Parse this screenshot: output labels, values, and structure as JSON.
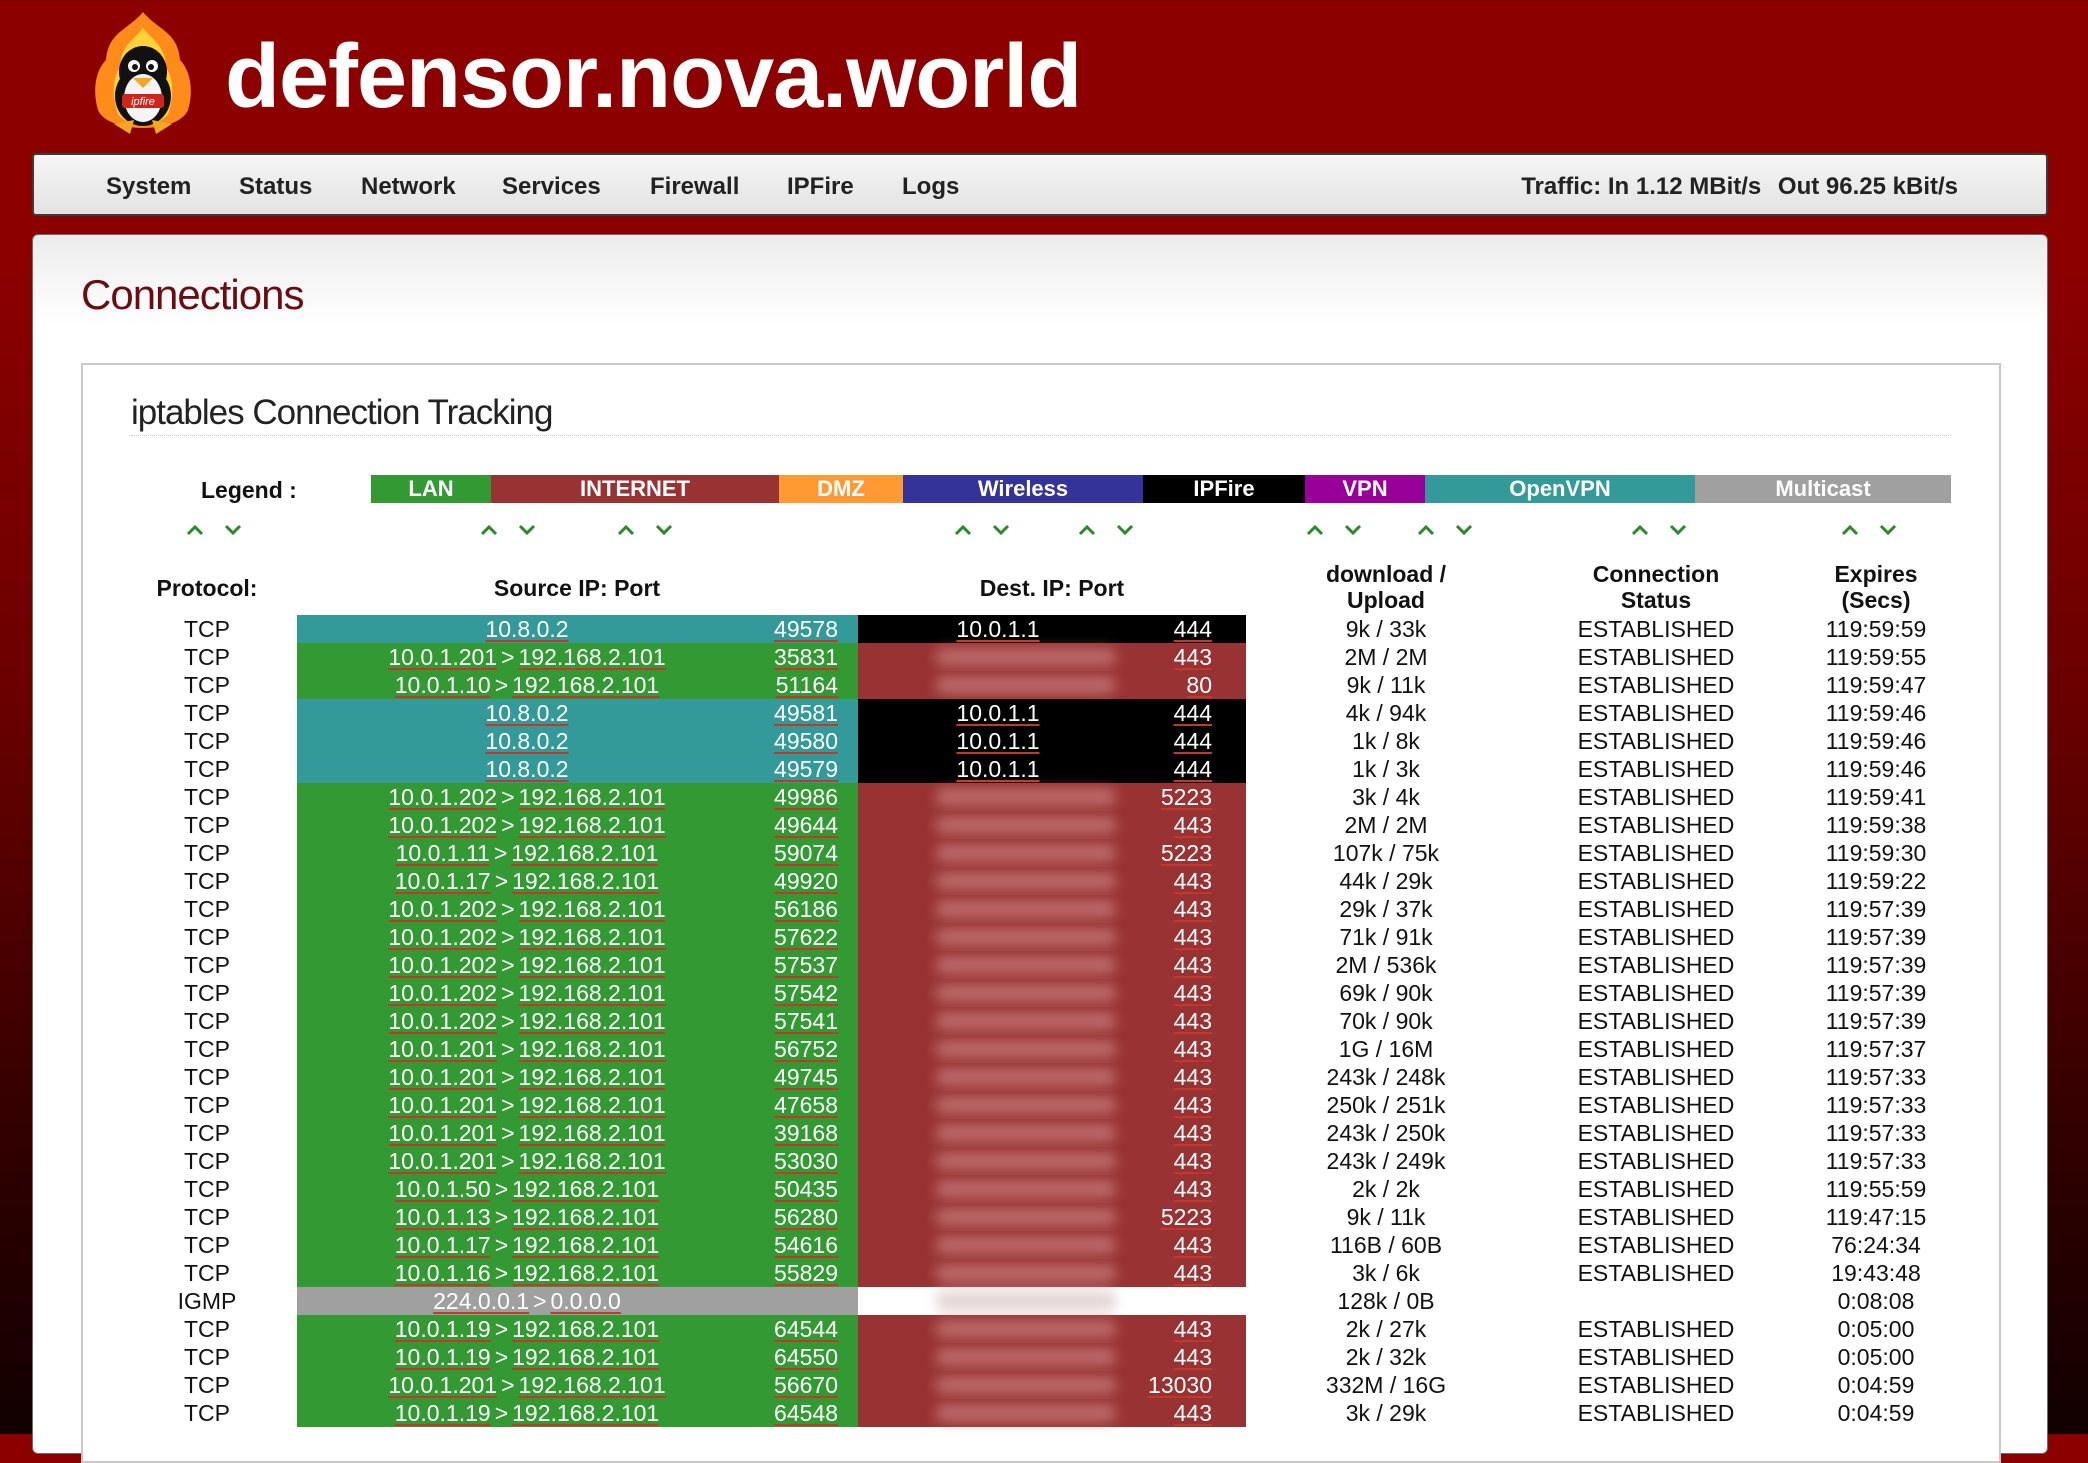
{
  "header": {
    "site_title": "defensor.nova.world",
    "logo_text": "ipfire"
  },
  "nav": {
    "items": [
      {
        "label": "System"
      },
      {
        "label": "Status"
      },
      {
        "label": "Network"
      },
      {
        "label": "Services"
      },
      {
        "label": "Firewall"
      },
      {
        "label": "IPFire"
      },
      {
        "label": "Logs"
      }
    ],
    "traffic_in": "Traffic: In 1.12 MBit/s",
    "traffic_out": "Out 96.25 kBit/s"
  },
  "page": {
    "heading": "Connections",
    "panel_title": "iptables Connection Tracking"
  },
  "legend": {
    "label": "Legend :",
    "items": [
      {
        "label": "LAN",
        "color": "#339933"
      },
      {
        "label": "INTERNET",
        "color": "#993333"
      },
      {
        "label": "DMZ",
        "color": "#ff9933"
      },
      {
        "label": "Wireless",
        "color": "#333399"
      },
      {
        "label": "IPFire",
        "color": "#000000"
      },
      {
        "label": "VPN",
        "color": "#990099"
      },
      {
        "label": "OpenVPN",
        "color": "#339999"
      },
      {
        "label": "Multicast",
        "color": "#a0a0a0"
      }
    ]
  },
  "columns": {
    "protocol": "Protocol:",
    "source": "Source IP: Port",
    "dest": "Dest. IP: Port",
    "download_line1": "download /",
    "download_line2": "Upload",
    "status_line1": "Connection",
    "status_line2": "Status",
    "expires_line1": "Expires",
    "expires_line2": "(Secs)"
  },
  "colors": {
    "lan": "#339933",
    "internet": "#993333",
    "openvpn": "#339999",
    "ipfire": "#000000",
    "multicast": "#a0a0a0",
    "arrow": "#2a8a2a"
  },
  "rows": [
    {
      "proto": "TCP",
      "src_type": "openvpn",
      "src_ip": "10.8.0.2",
      "src_nat": "",
      "src_port": "49578",
      "dst_type": "ipfire",
      "dst_ip": "10.0.1.1",
      "dst_port": "444",
      "traffic": "9k / 33k",
      "status": "ESTABLISHED",
      "expires": "119:59:59"
    },
    {
      "proto": "TCP",
      "src_type": "lan",
      "src_ip": "10.0.1.201",
      "src_nat": "192.168.2.101",
      "src_port": "35831",
      "dst_type": "internet",
      "dst_ip": "",
      "dst_port": "443",
      "traffic": "2M / 2M",
      "status": "ESTABLISHED",
      "expires": "119:59:55"
    },
    {
      "proto": "TCP",
      "src_type": "lan",
      "src_ip": "10.0.1.10",
      "src_nat": "192.168.2.101",
      "src_port": "51164",
      "dst_type": "internet",
      "dst_ip": "",
      "dst_port": "80",
      "traffic": "9k / 11k",
      "status": "ESTABLISHED",
      "expires": "119:59:47"
    },
    {
      "proto": "TCP",
      "src_type": "openvpn",
      "src_ip": "10.8.0.2",
      "src_nat": "",
      "src_port": "49581",
      "dst_type": "ipfire",
      "dst_ip": "10.0.1.1",
      "dst_port": "444",
      "traffic": "4k / 94k",
      "status": "ESTABLISHED",
      "expires": "119:59:46"
    },
    {
      "proto": "TCP",
      "src_type": "openvpn",
      "src_ip": "10.8.0.2",
      "src_nat": "",
      "src_port": "49580",
      "dst_type": "ipfire",
      "dst_ip": "10.0.1.1",
      "dst_port": "444",
      "traffic": "1k / 8k",
      "status": "ESTABLISHED",
      "expires": "119:59:46"
    },
    {
      "proto": "TCP",
      "src_type": "openvpn",
      "src_ip": "10.8.0.2",
      "src_nat": "",
      "src_port": "49579",
      "dst_type": "ipfire",
      "dst_ip": "10.0.1.1",
      "dst_port": "444",
      "traffic": "1k / 3k",
      "status": "ESTABLISHED",
      "expires": "119:59:46"
    },
    {
      "proto": "TCP",
      "src_type": "lan",
      "src_ip": "10.0.1.202",
      "src_nat": "192.168.2.101",
      "src_port": "49986",
      "dst_type": "internet",
      "dst_ip": "",
      "dst_port": "5223",
      "traffic": "3k / 4k",
      "status": "ESTABLISHED",
      "expires": "119:59:41"
    },
    {
      "proto": "TCP",
      "src_type": "lan",
      "src_ip": "10.0.1.202",
      "src_nat": "192.168.2.101",
      "src_port": "49644",
      "dst_type": "internet",
      "dst_ip": "",
      "dst_port": "443",
      "traffic": "2M / 2M",
      "status": "ESTABLISHED",
      "expires": "119:59:38"
    },
    {
      "proto": "TCP",
      "src_type": "lan",
      "src_ip": "10.0.1.11",
      "src_nat": "192.168.2.101",
      "src_port": "59074",
      "dst_type": "internet",
      "dst_ip": "",
      "dst_port": "5223",
      "traffic": "107k / 75k",
      "status": "ESTABLISHED",
      "expires": "119:59:30"
    },
    {
      "proto": "TCP",
      "src_type": "lan",
      "src_ip": "10.0.1.17",
      "src_nat": "192.168.2.101",
      "src_port": "49920",
      "dst_type": "internet",
      "dst_ip": "",
      "dst_port": "443",
      "traffic": "44k / 29k",
      "status": "ESTABLISHED",
      "expires": "119:59:22"
    },
    {
      "proto": "TCP",
      "src_type": "lan",
      "src_ip": "10.0.1.202",
      "src_nat": "192.168.2.101",
      "src_port": "56186",
      "dst_type": "internet",
      "dst_ip": "",
      "dst_port": "443",
      "traffic": "29k / 37k",
      "status": "ESTABLISHED",
      "expires": "119:57:39"
    },
    {
      "proto": "TCP",
      "src_type": "lan",
      "src_ip": "10.0.1.202",
      "src_nat": "192.168.2.101",
      "src_port": "57622",
      "dst_type": "internet",
      "dst_ip": "",
      "dst_port": "443",
      "traffic": "71k / 91k",
      "status": "ESTABLISHED",
      "expires": "119:57:39"
    },
    {
      "proto": "TCP",
      "src_type": "lan",
      "src_ip": "10.0.1.202",
      "src_nat": "192.168.2.101",
      "src_port": "57537",
      "dst_type": "internet",
      "dst_ip": "",
      "dst_port": "443",
      "traffic": "2M / 536k",
      "status": "ESTABLISHED",
      "expires": "119:57:39"
    },
    {
      "proto": "TCP",
      "src_type": "lan",
      "src_ip": "10.0.1.202",
      "src_nat": "192.168.2.101",
      "src_port": "57542",
      "dst_type": "internet",
      "dst_ip": "",
      "dst_port": "443",
      "traffic": "69k / 90k",
      "status": "ESTABLISHED",
      "expires": "119:57:39"
    },
    {
      "proto": "TCP",
      "src_type": "lan",
      "src_ip": "10.0.1.202",
      "src_nat": "192.168.2.101",
      "src_port": "57541",
      "dst_type": "internet",
      "dst_ip": "",
      "dst_port": "443",
      "traffic": "70k / 90k",
      "status": "ESTABLISHED",
      "expires": "119:57:39"
    },
    {
      "proto": "TCP",
      "src_type": "lan",
      "src_ip": "10.0.1.201",
      "src_nat": "192.168.2.101",
      "src_port": "56752",
      "dst_type": "internet",
      "dst_ip": "",
      "dst_port": "443",
      "traffic": "1G / 16M",
      "status": "ESTABLISHED",
      "expires": "119:57:37"
    },
    {
      "proto": "TCP",
      "src_type": "lan",
      "src_ip": "10.0.1.201",
      "src_nat": "192.168.2.101",
      "src_port": "49745",
      "dst_type": "internet",
      "dst_ip": "",
      "dst_port": "443",
      "traffic": "243k / 248k",
      "status": "ESTABLISHED",
      "expires": "119:57:33"
    },
    {
      "proto": "TCP",
      "src_type": "lan",
      "src_ip": "10.0.1.201",
      "src_nat": "192.168.2.101",
      "src_port": "47658",
      "dst_type": "internet",
      "dst_ip": "",
      "dst_port": "443",
      "traffic": "250k / 251k",
      "status": "ESTABLISHED",
      "expires": "119:57:33"
    },
    {
      "proto": "TCP",
      "src_type": "lan",
      "src_ip": "10.0.1.201",
      "src_nat": "192.168.2.101",
      "src_port": "39168",
      "dst_type": "internet",
      "dst_ip": "",
      "dst_port": "443",
      "traffic": "243k / 250k",
      "status": "ESTABLISHED",
      "expires": "119:57:33"
    },
    {
      "proto": "TCP",
      "src_type": "lan",
      "src_ip": "10.0.1.201",
      "src_nat": "192.168.2.101",
      "src_port": "53030",
      "dst_type": "internet",
      "dst_ip": "",
      "dst_port": "443",
      "traffic": "243k / 249k",
      "status": "ESTABLISHED",
      "expires": "119:57:33"
    },
    {
      "proto": "TCP",
      "src_type": "lan",
      "src_ip": "10.0.1.50",
      "src_nat": "192.168.2.101",
      "src_port": "50435",
      "dst_type": "internet",
      "dst_ip": "",
      "dst_port": "443",
      "traffic": "2k / 2k",
      "status": "ESTABLISHED",
      "expires": "119:55:59"
    },
    {
      "proto": "TCP",
      "src_type": "lan",
      "src_ip": "10.0.1.13",
      "src_nat": "192.168.2.101",
      "src_port": "56280",
      "dst_type": "internet",
      "dst_ip": "",
      "dst_port": "5223",
      "traffic": "9k / 11k",
      "status": "ESTABLISHED",
      "expires": "119:47:15"
    },
    {
      "proto": "TCP",
      "src_type": "lan",
      "src_ip": "10.0.1.17",
      "src_nat": "192.168.2.101",
      "src_port": "54616",
      "dst_type": "internet",
      "dst_ip": "",
      "dst_port": "443",
      "traffic": "116B / 60B",
      "status": "ESTABLISHED",
      "expires": "76:24:34"
    },
    {
      "proto": "TCP",
      "src_type": "lan",
      "src_ip": "10.0.1.16",
      "src_nat": "192.168.2.101",
      "src_port": "55829",
      "dst_type": "internet",
      "dst_ip": "",
      "dst_port": "443",
      "traffic": "3k / 6k",
      "status": "ESTABLISHED",
      "expires": "19:43:48"
    },
    {
      "proto": "IGMP",
      "src_type": "multicast",
      "src_ip": "224.0.0.1",
      "src_nat": "0.0.0.0",
      "src_port": "",
      "dst_type": "none",
      "dst_ip": "",
      "dst_port": "",
      "traffic": "128k / 0B",
      "status": "",
      "expires": "0:08:08"
    },
    {
      "proto": "TCP",
      "src_type": "lan",
      "src_ip": "10.0.1.19",
      "src_nat": "192.168.2.101",
      "src_port": "64544",
      "dst_type": "internet",
      "dst_ip": "",
      "dst_port": "443",
      "traffic": "2k / 27k",
      "status": "ESTABLISHED",
      "expires": "0:05:00"
    },
    {
      "proto": "TCP",
      "src_type": "lan",
      "src_ip": "10.0.1.19",
      "src_nat": "192.168.2.101",
      "src_port": "64550",
      "dst_type": "internet",
      "dst_ip": "",
      "dst_port": "443",
      "traffic": "2k / 32k",
      "status": "ESTABLISHED",
      "expires": "0:05:00"
    },
    {
      "proto": "TCP",
      "src_type": "lan",
      "src_ip": "10.0.1.201",
      "src_nat": "192.168.2.101",
      "src_port": "56670",
      "dst_type": "internet",
      "dst_ip": "",
      "dst_port": "13030",
      "traffic": "332M / 16G",
      "status": "ESTABLISHED",
      "expires": "0:04:59"
    },
    {
      "proto": "TCP",
      "src_type": "lan",
      "src_ip": "10.0.1.19",
      "src_nat": "192.168.2.101",
      "src_port": "64548",
      "dst_type": "internet",
      "dst_ip": "",
      "dst_port": "443",
      "traffic": "3k / 29k",
      "status": "ESTABLISHED",
      "expires": "0:04:59"
    }
  ]
}
